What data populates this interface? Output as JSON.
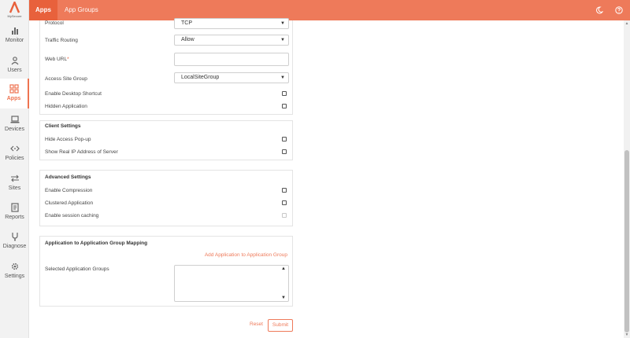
{
  "sidebar": {
    "logo_text": "MySecure",
    "items": [
      {
        "label": "Monitor",
        "icon": "bar-chart-icon"
      },
      {
        "label": "Users",
        "icon": "user-icon"
      },
      {
        "label": "Apps",
        "icon": "apps-grid-icon",
        "active": true
      },
      {
        "label": "Devices",
        "icon": "laptop-icon"
      },
      {
        "label": "Policies",
        "icon": "code-arrows-icon"
      },
      {
        "label": "Sites",
        "icon": "swap-arrows-icon"
      },
      {
        "label": "Reports",
        "icon": "document-icon"
      },
      {
        "label": "Diagnose",
        "icon": "stethoscope-icon"
      },
      {
        "label": "Settings",
        "icon": "gear-icon"
      }
    ]
  },
  "topbar": {
    "tabs": [
      "Apps",
      "App Groups"
    ],
    "icons": [
      "theme-moon-icon",
      "help-icon"
    ]
  },
  "app_settings": {
    "protocol_label": "Protocol",
    "protocol_value": "TCP",
    "traffic_routing_label": "Traffic Routing",
    "traffic_routing_value": "Allow",
    "web_url_label": "Web URL",
    "web_url_required_mark": "*",
    "web_url_value": "",
    "access_site_group_label": "Access Site Group",
    "access_site_group_value": "LocalSiteGroup",
    "desktop_shortcut_label": "Enable Desktop Shortcut",
    "hidden_application_label": "Hidden Application"
  },
  "client_settings": {
    "title": "Client Settings",
    "hide_popup_label": "Hide Access Pop-up",
    "show_real_ip_label": "Show Real IP Address of Server"
  },
  "advanced_settings": {
    "title": "Advanced Settings",
    "compression_label": "Enable Compression",
    "clustered_label": "Clustered Application",
    "session_caching_label": "Enable session caching"
  },
  "group_mapping": {
    "title": "Application to Application Group Mapping",
    "add_link": "Add Application to Application Group",
    "selected_label": "Selected Application Groups"
  },
  "actions": {
    "reset": "Reset",
    "submit": "Submit"
  },
  "colors": {
    "accent": "#ee7a5a",
    "accent_dark": "#e8613c"
  }
}
